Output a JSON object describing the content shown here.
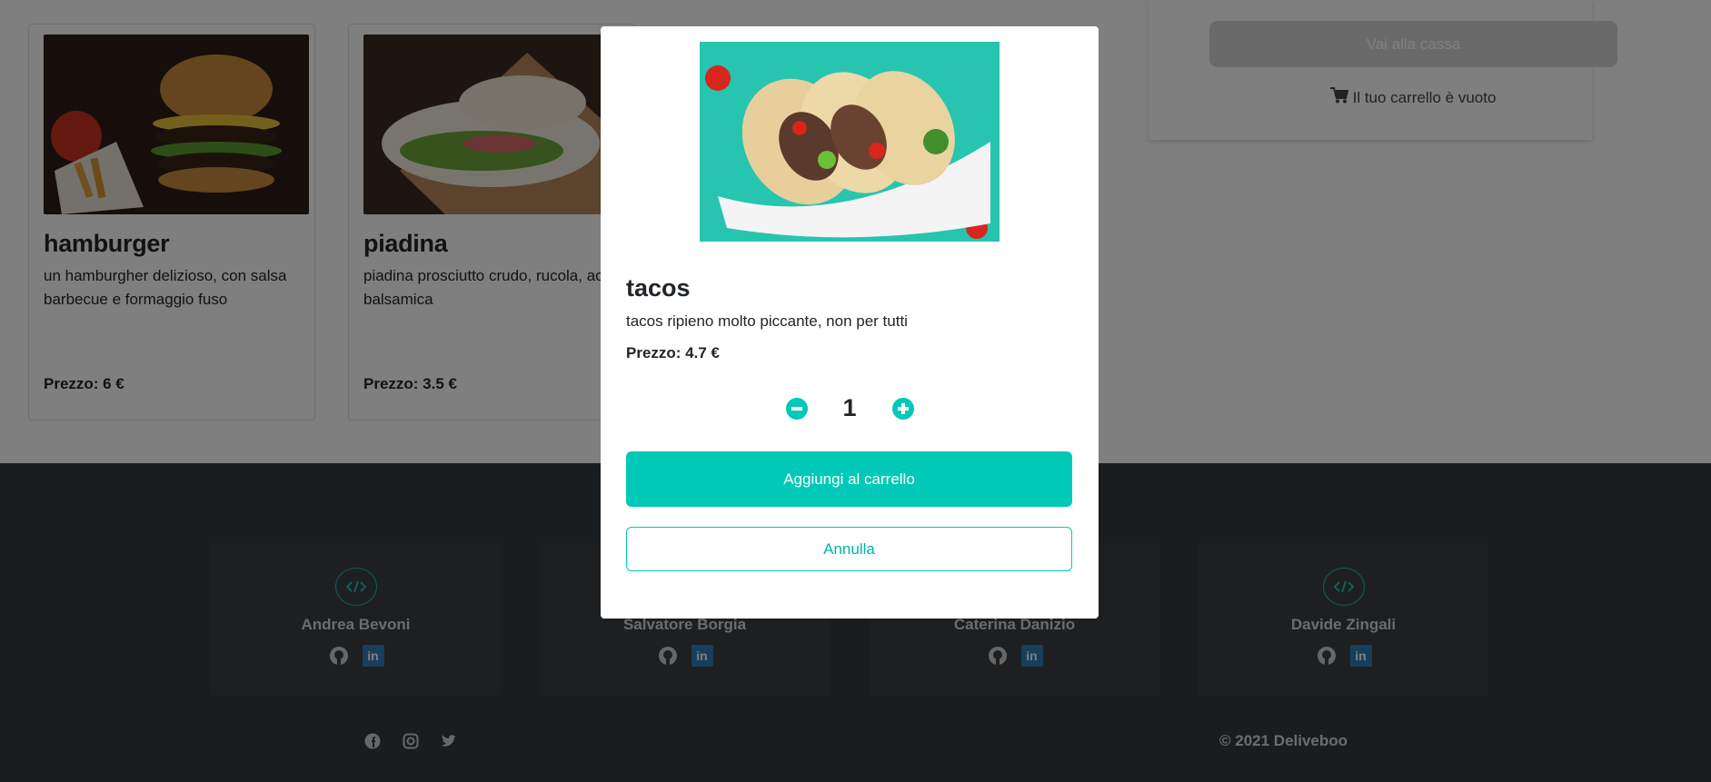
{
  "menu": {
    "items": [
      {
        "name": "hamburger",
        "description": "un hamburgher delizioso, con salsa barbecue e formaggio fuso",
        "price": "Prezzo: 6 €"
      },
      {
        "name": "piadina",
        "description": "piadina prosciutto crudo, rucola, aceto balsamica",
        "price": "Prezzo: 3.5 €"
      }
    ]
  },
  "cart": {
    "checkout_label": "Vai alla cassa",
    "empty_label": "Il tuo carrello è vuoto"
  },
  "modal": {
    "title": "tacos",
    "description": "tacos ripieno molto piccante, non per tutti",
    "price": "Prezzo: 4.7 €",
    "quantity": "1",
    "add_label": "Aggiungi al carrello",
    "cancel_label": "Annulla"
  },
  "footer": {
    "developers": [
      {
        "name": "Andrea Bevoni"
      },
      {
        "name": "Salvatore Borgia"
      },
      {
        "name": "Caterina Danizio"
      },
      {
        "name": "Davide Zingali"
      }
    ],
    "socials": [
      "facebook-icon",
      "instagram-icon",
      "twitter-icon"
    ],
    "copyright": "© 2021 Deliveboo"
  },
  "colors": {
    "accent": "#00c9b7",
    "footer_bg": "#343a40",
    "linkedin": "#2f7fb6"
  }
}
